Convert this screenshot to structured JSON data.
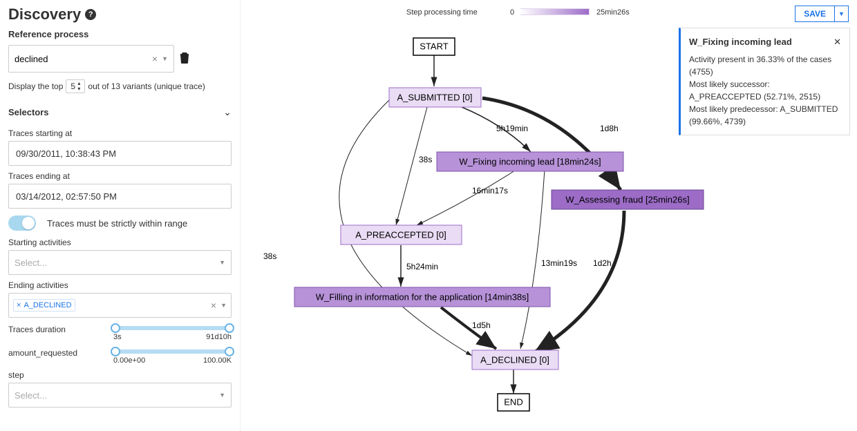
{
  "sidebar": {
    "title": "Discovery",
    "reference_heading": "Reference process",
    "reference_value": "declined",
    "variant_prefix": "Display the top",
    "variant_n": "5",
    "variant_suffix": "out of 13 variants (unique trace)",
    "selectors_heading": "Selectors",
    "start_label": "Traces starting at",
    "start_value": "09/30/2011, 10:38:43 PM",
    "end_label": "Traces ending at",
    "end_value": "03/14/2012, 02:57:50 PM",
    "range_toggle_label": "Traces must be strictly within range",
    "starting_activities_label": "Starting activities",
    "select_placeholder": "Select...",
    "ending_activities_label": "Ending activities",
    "ending_tag": "A_DECLINED",
    "slider1_label": "Traces duration",
    "slider1_min": "3s",
    "slider1_max": "91d10h",
    "slider2_label": "amount_requested",
    "slider2_min": "0.00e+00",
    "slider2_max": "100.00K",
    "step_label": "step"
  },
  "legend": {
    "label": "Step processing time",
    "zero": "0",
    "max": "25min26s"
  },
  "save": {
    "label": "SAVE"
  },
  "nodes": {
    "start": "START",
    "end": "END",
    "a_submitted": "A_SUBMITTED [0]",
    "w_fixing": "W_Fixing incoming lead [18min24s]",
    "w_assessing": "W_Assessing fraud [25min26s]",
    "a_preaccepted": "A_PREACCEPTED [0]",
    "w_filling": "W_Filling in information for the application [14min38s]",
    "a_declined": "A_DECLINED [0]"
  },
  "edges": {
    "e1": "5h19min",
    "e2": "1d8h",
    "e3": "38s",
    "e4": "38s",
    "e5": "16min17s",
    "e6": "5h24min",
    "e7": "13min19s",
    "e8": "1d2h",
    "e9": "1d5h"
  },
  "info_panel": {
    "title": "W_Fixing incoming lead",
    "line1": "Activity present in 36.33% of the cases (4755)",
    "line2a": "Most likely successor:",
    "line2b": "A_PREACCEPTED (52.71%, 2515)",
    "line3": "Most likely predecessor: A_SUBMITTED (99.66%, 4739)"
  }
}
